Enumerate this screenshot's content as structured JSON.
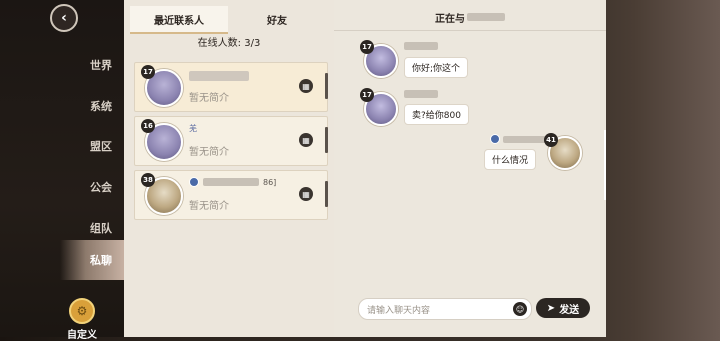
{
  "nav": {
    "back_icon": "chevron-left-icon",
    "items": [
      {
        "label": "世界"
      },
      {
        "label": "系统"
      },
      {
        "label": "盟区"
      },
      {
        "label": "公会"
      },
      {
        "label": "组队"
      },
      {
        "label": "私聊"
      }
    ],
    "custom_label": "自定义",
    "custom_icon": "gear-icon"
  },
  "contacts": {
    "tabs": [
      {
        "label": "最近联系人"
      },
      {
        "label": "好友"
      }
    ],
    "online_text": "在线人数: 3/3",
    "list": [
      {
        "level": "17",
        "bio": "暂无简介",
        "name_suffix": ""
      },
      {
        "level": "16",
        "bio": "暂无简介",
        "name_suffix": "羌"
      },
      {
        "level": "38",
        "bio": "暂无简介",
        "name_suffix": "86]"
      }
    ]
  },
  "chat": {
    "header_prefix": "正在与",
    "header_suffix": "",
    "messages": [
      {
        "from": "other",
        "level": "17",
        "text": "你好;你这个"
      },
      {
        "from": "other",
        "level": "17",
        "text": "卖?给你800"
      },
      {
        "from": "self",
        "level": "41",
        "text": "什么情况"
      }
    ],
    "input_placeholder": "请输入聊天内容",
    "send_label": "发送"
  },
  "colors": {
    "accent": "#d6b98a",
    "dark": "#2b2622",
    "panel": "#ece6dc"
  }
}
